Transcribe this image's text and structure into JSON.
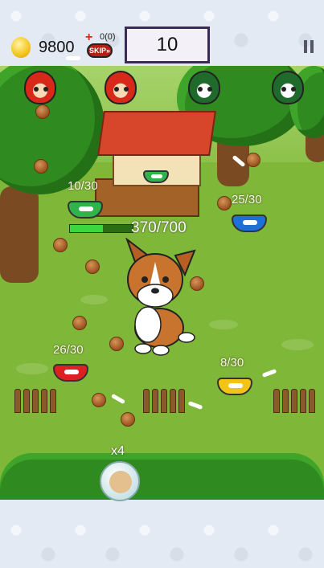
{
  "hud": {
    "coin_count": "9800",
    "revive_plus": "+",
    "revive_count": "0(0)",
    "skip_label": "SKIP»",
    "score": "10"
  },
  "enemies": [
    {
      "color": "red",
      "name": "red-enemy-head"
    },
    {
      "color": "red",
      "name": "red-enemy-head"
    },
    {
      "color": "green",
      "name": "green-enemy-head"
    },
    {
      "color": "green",
      "name": "green-enemy-head"
    }
  ],
  "bowls": [
    {
      "label": "10/30",
      "color": "#2fb34a",
      "name": "green-bowl-1"
    },
    {
      "label": "25/30",
      "color": "#1e6fd6",
      "name": "blue-bowl"
    },
    {
      "label": "26/30",
      "color": "#dd2020",
      "name": "red-bowl"
    },
    {
      "label": "8/30",
      "color": "#f2c418",
      "name": "yellow-bowl"
    }
  ],
  "pet": {
    "health_text": "370/700",
    "health_fraction": 0.53
  },
  "pet_bubble": {
    "multiplier": "x4"
  },
  "colors": {
    "grass": "#7fb838",
    "health_fill": "#3bd640"
  }
}
